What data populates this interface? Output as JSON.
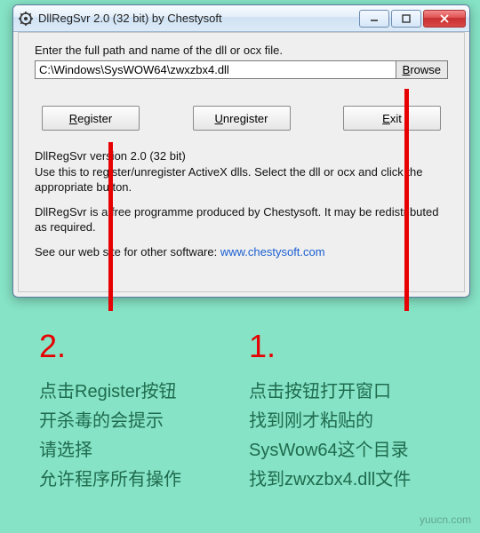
{
  "window": {
    "title": "DllRegSvr 2.0 (32 bit) by Chestysoft",
    "instruction": "Enter the full path and name of the dll or ocx file.",
    "path_value": "C:\\Windows\\SysWOW64\\zwxzbx4.dll",
    "browse": "Browse",
    "buttons": {
      "register_pre": "R",
      "register_post": "egister",
      "unregister_pre": "U",
      "unregister_post": "nregister",
      "exit_pre": "E",
      "exit_post": "xit"
    },
    "info_version": "DllRegSvr version 2.0 (32 bit)",
    "info_usage": "Use this to register/unregister ActiveX dlls. Select the dll or ocx and click the appropriate button.",
    "info_free": "DllRegSvr is a free programme produced by Chestysoft. It may be redistributed as required.",
    "info_seeweb": "See our web site for other software:   ",
    "info_url": "www.chestysoft.com"
  },
  "annot": {
    "col1": {
      "num": "2.",
      "l1": "点击Register按钮",
      "l2": "开杀毒的会提示",
      "l3": "请选择",
      "l4": "允许程序所有操作"
    },
    "col2": {
      "num": "1.",
      "l1": "点击按钮打开窗口",
      "l2": "找到刚才粘贴的",
      "l3": "SysWow64这个目录",
      "l4": "找到zwxzbx4.dll文件"
    }
  },
  "watermark": "yuucn.com"
}
